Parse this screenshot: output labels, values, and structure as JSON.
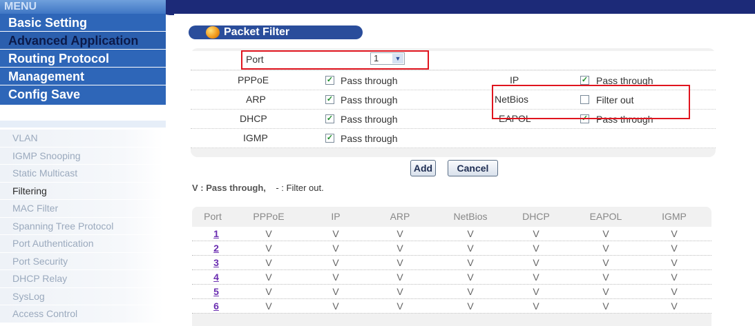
{
  "menu": {
    "header": "MENU",
    "main_items": [
      "Basic Setting",
      "Advanced Application",
      "Routing Protocol",
      "Management",
      "Config Save"
    ],
    "sub_items": [
      "VLAN",
      "IGMP Snooping",
      "Static Multicast",
      "Filtering",
      "MAC Filter",
      "Spanning Tree Protocol",
      "Port Authentication",
      "Port Security",
      "DHCP Relay",
      "SysLog",
      "Access Control"
    ]
  },
  "panel": {
    "title": "Packet Filter",
    "port_label": "Port",
    "port_value": "1",
    "left_protocols": [
      {
        "name": "PPPoE",
        "checked": true,
        "state": "Pass through"
      },
      {
        "name": "ARP",
        "checked": true,
        "state": "Pass through"
      },
      {
        "name": "DHCP",
        "checked": true,
        "state": "Pass through"
      },
      {
        "name": "IGMP",
        "checked": true,
        "state": "Pass through"
      }
    ],
    "right_protocols": [
      {
        "name": "IP",
        "checked": true,
        "state": "Pass through"
      },
      {
        "name": "NetBios",
        "checked": false,
        "state": "Filter out"
      },
      {
        "name": "EAPOL",
        "checked": true,
        "state": "Pass through"
      }
    ]
  },
  "buttons": {
    "add": "Add",
    "cancel": "Cancel"
  },
  "legend": {
    "pass": "V : Pass through,",
    "filter": "- : Filter out."
  },
  "table": {
    "headers": [
      "Port",
      "PPPoE",
      "IP",
      "ARP",
      "NetBios",
      "DHCP",
      "EAPOL",
      "IGMP"
    ],
    "rows": [
      [
        "1",
        "V",
        "V",
        "V",
        "V",
        "V",
        "V",
        "V"
      ],
      [
        "2",
        "V",
        "V",
        "V",
        "V",
        "V",
        "V",
        "V"
      ],
      [
        "3",
        "V",
        "V",
        "V",
        "V",
        "V",
        "V",
        "V"
      ],
      [
        "4",
        "V",
        "V",
        "V",
        "V",
        "V",
        "V",
        "V"
      ],
      [
        "5",
        "V",
        "V",
        "V",
        "V",
        "V",
        "V",
        "V"
      ],
      [
        "6",
        "V",
        "V",
        "V",
        "V",
        "V",
        "V",
        "V"
      ]
    ]
  },
  "colors": {
    "menu_blue": "#2e66b8",
    "title_blue": "#2a4d9b",
    "highlight_red": "#e0141e",
    "top_bar": "#1c2a78"
  },
  "icons": {
    "select_arrow": "chevron-down-icon",
    "check": "check-icon",
    "title_bullet": "orange-orb-icon"
  }
}
